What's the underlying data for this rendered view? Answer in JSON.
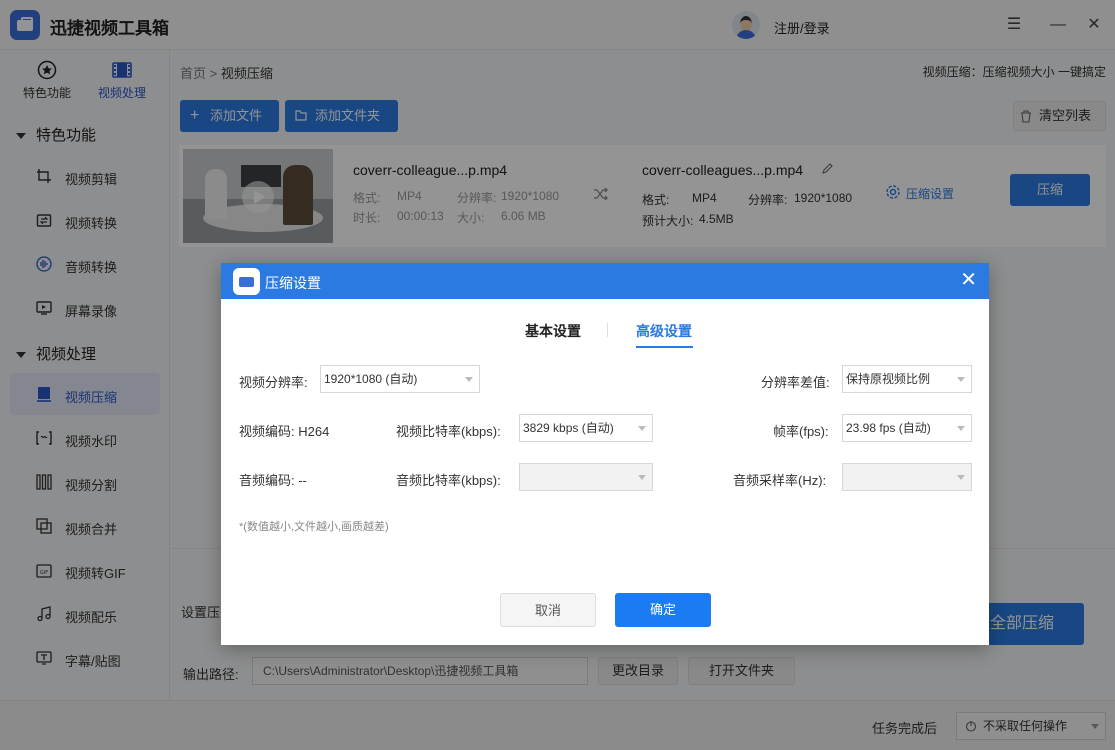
{
  "app": {
    "title": "迅捷视频工具箱",
    "login": "注册/登录"
  },
  "window": {
    "menu": "☰",
    "minimize": "—",
    "close": "✕"
  },
  "sidebar": {
    "tabs": [
      {
        "label": "特色功能"
      },
      {
        "label": "视频处理"
      }
    ],
    "section1": "特色功能",
    "section2": "视频处理",
    "items": [
      {
        "label": "视频剪辑"
      },
      {
        "label": "视频转换"
      },
      {
        "label": "音频转换"
      },
      {
        "label": "屏幕录像"
      },
      {
        "label": "视频压缩"
      },
      {
        "label": "视频水印"
      },
      {
        "label": "视频分割"
      },
      {
        "label": "视频合并"
      },
      {
        "label": "视频转GIF"
      },
      {
        "label": "视频配乐"
      },
      {
        "label": "字幕/贴图"
      }
    ]
  },
  "main": {
    "breadcrumb_home": "首页",
    "breadcrumb_sep": ">",
    "breadcrumb_current": "视频压缩",
    "description": "视频压缩：压缩视频大小 一键搞定",
    "add_file": "添加文件",
    "add_folder": "添加文件夹",
    "clear_list": "清空列表"
  },
  "file": {
    "src_name": "coverr-colleague...p.mp4",
    "format_label": "格式:",
    "format": "MP4",
    "resolution_label": "分辨率:",
    "resolution": "1920*1080",
    "duration_label": "时长:",
    "duration": "00:00:13",
    "size_label": "大小:",
    "size": "6.06 MB",
    "out_name": "coverr-colleagues...p.mp4",
    "out_format": "MP4",
    "out_resolution": "1920*1080",
    "est_size_label": "预计大小:",
    "est_size": "4.5MB",
    "settings_link": "压缩设置",
    "compress_button": "压缩"
  },
  "bottom": {
    "settings_partial": "设置压",
    "compress_all": "全部压缩",
    "output_label": "输出路径:",
    "output_path": "C:\\Users\\Administrator\\Desktop\\迅捷视频工具箱",
    "change_dir": "更改目录",
    "open_folder": "打开文件夹",
    "after_task_label": "任务完成后",
    "after_task_value": "不采取任何操作"
  },
  "dialog": {
    "title": "压缩设置",
    "tab_basic": "基本设置",
    "tab_advanced": "高级设置",
    "video_resolution_label": "视频分辨率:",
    "video_resolution_value": "1920*1080 (自动)",
    "resolution_diff_label": "分辨率差值:",
    "resolution_diff_value": "保持原视频比例",
    "video_codec_label": "视频编码: H264",
    "video_bitrate_label": "视频比特率(kbps):",
    "video_bitrate_value": "3829 kbps (自动)",
    "fps_label": "帧率(fps):",
    "fps_value": "23.98 fps (自动)",
    "audio_codec_label": "音频编码: --",
    "audio_bitrate_label": "音频比特率(kbps):",
    "audio_bitrate_value": "",
    "audio_sample_label": "音频采样率(Hz):",
    "audio_sample_value": "",
    "note": "*(数值越小,文件越小,画质越差)",
    "cancel": "取消",
    "confirm": "确定"
  }
}
